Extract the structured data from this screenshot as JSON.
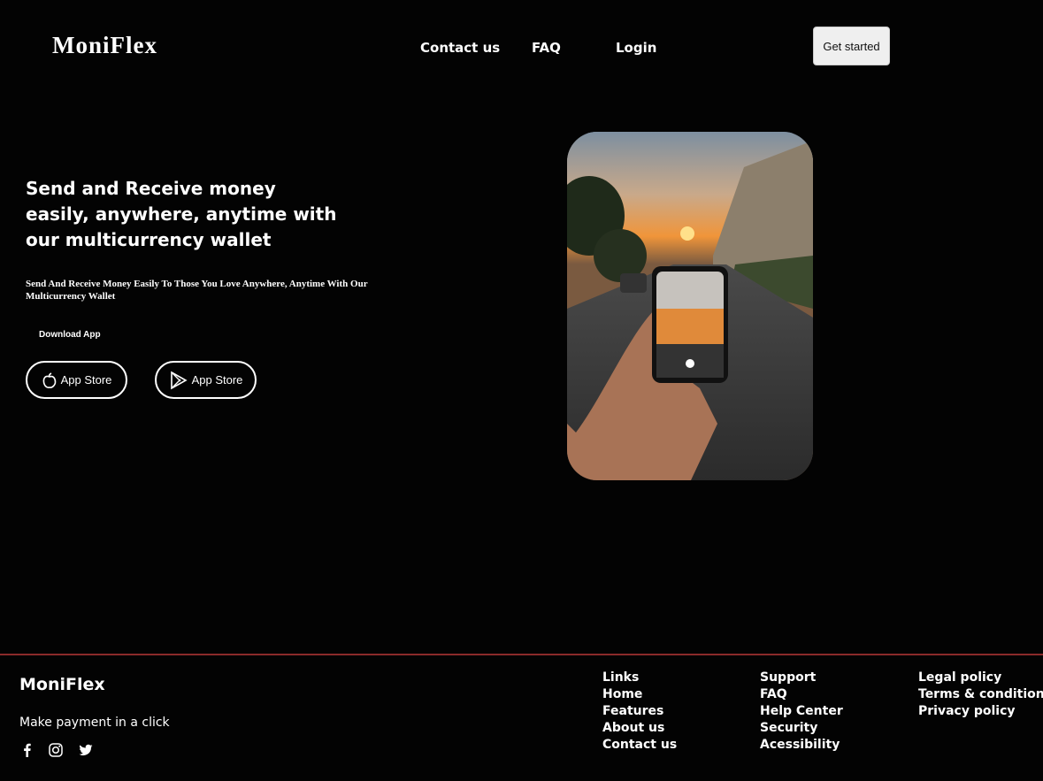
{
  "header": {
    "brand": "MoniFlex",
    "nav": [
      "Contact us",
      "FAQ",
      "Login"
    ],
    "cta": "Get started"
  },
  "hero": {
    "title": "Send and Receive money easily, anywhere, anytime with our multicurrency wallet",
    "subtitle": "Send And Receive Money Easily To Those You Love Anywhere, Anytime With Our Multicurrency Wallet",
    "download_label": "Download App",
    "apple_button": "App Store",
    "google_button": "App Store"
  },
  "footer": {
    "brand": "MoniFlex",
    "tagline": "Make payment in a click",
    "social_icons": [
      "facebook-icon",
      "instagram-icon",
      "twitter-icon"
    ],
    "columns": [
      [
        "Links",
        "Home",
        "Features",
        "About us",
        "Contact us"
      ],
      [
        "Support",
        "FAQ",
        "Help Center",
        "Security",
        "Acessibility"
      ],
      [
        "Legal policy",
        "Terms & condition",
        "Privacy policy"
      ]
    ]
  },
  "colors": {
    "background": "#030303",
    "text": "#ffffff",
    "footer_divider": "#8a2a2a",
    "cta_background": "#efefef"
  }
}
